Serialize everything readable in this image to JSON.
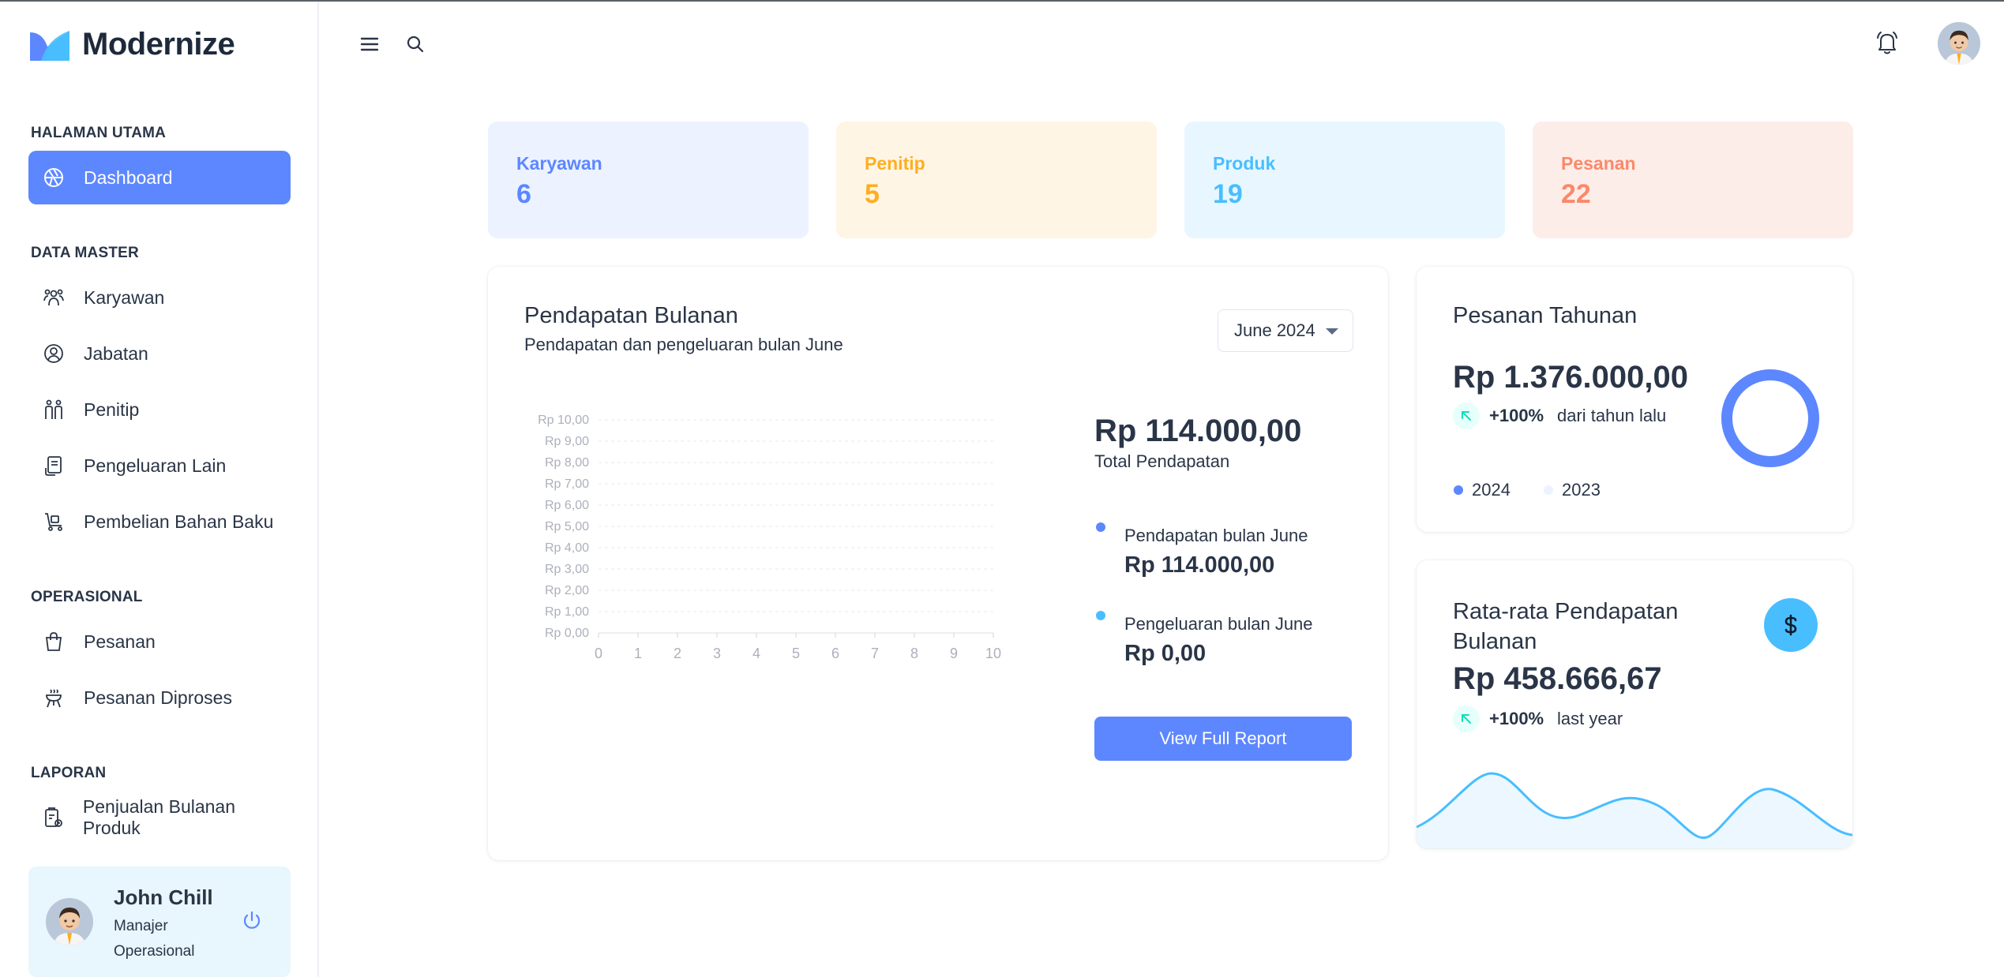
{
  "brand": {
    "name": "Modernize"
  },
  "sidebar": {
    "sections": [
      {
        "title": "HALAMAN UTAMA"
      },
      {
        "title": "DATA MASTER"
      },
      {
        "title": "OPERASIONAL"
      },
      {
        "title": "LAPORAN"
      }
    ],
    "items": [
      {
        "label": "Dashboard",
        "icon": "aperture-icon",
        "active": true
      },
      {
        "label": "Karyawan",
        "icon": "users-icon"
      },
      {
        "label": "Jabatan",
        "icon": "user-circle-icon"
      },
      {
        "label": "Penitip",
        "icon": "friends-icon"
      },
      {
        "label": "Pengeluaran Lain",
        "icon": "receipt-icon"
      },
      {
        "label": "Pembelian Bahan Baku",
        "icon": "cart-icon"
      },
      {
        "label": "Pesanan",
        "icon": "shopping-bag-icon"
      },
      {
        "label": "Pesanan Diproses",
        "icon": "grill-icon"
      },
      {
        "label": "Penjualan Bulanan Produk",
        "icon": "report-icon"
      }
    ]
  },
  "user": {
    "name": "John Chill",
    "role": "Manajer Operasional"
  },
  "stats": [
    {
      "label": "Karyawan",
      "value": "6",
      "color": "#5d87ff",
      "bg": "#ecf2ff"
    },
    {
      "label": "Penitip",
      "value": "5",
      "color": "#ffae1f",
      "bg": "#fef5e5"
    },
    {
      "label": "Produk",
      "value": "19",
      "color": "#49beff",
      "bg": "#e8f7ff"
    },
    {
      "label": "Pesanan",
      "value": "22",
      "color": "#fa896b",
      "bg": "#fdede8"
    }
  ],
  "monthly": {
    "title": "Pendapatan Bulanan",
    "subtitle": "Pendapatan dan pengeluaran bulan June",
    "month_select": "June 2024",
    "total_value": "Rp 114.000,00",
    "total_label": "Total Pendapatan",
    "income_label": "Pendapatan bulan June",
    "income_value": "Rp 114.000,00",
    "expense_label": "Pengeluaran bulan June",
    "expense_value": "Rp 0,00",
    "button": "View Full Report"
  },
  "chart_data": {
    "type": "line",
    "x": [
      0,
      1,
      2,
      3,
      4,
      5,
      6,
      7,
      8,
      9,
      10
    ],
    "y_ticks": [
      "Rp 0,00",
      "Rp 1,00",
      "Rp 2,00",
      "Rp 3,00",
      "Rp 4,00",
      "Rp 5,00",
      "Rp 6,00",
      "Rp 7,00",
      "Rp 8,00",
      "Rp 9,00",
      "Rp 10,00"
    ],
    "xlim": [
      0,
      10
    ],
    "ylim": [
      0,
      10
    ],
    "series": [],
    "grid": true
  },
  "yearly": {
    "title": "Pesanan Tahunan",
    "value": "Rp 1.376.000,00",
    "trend_pct": "+100%",
    "trend_text": "dari tahun lalu",
    "legend": [
      {
        "label": "2024",
        "color": "#5d87ff"
      },
      {
        "label": "2023",
        "color": "#ecf2ff"
      }
    ],
    "donut_color": "#5d87ff"
  },
  "average": {
    "title": "Rata-rata Pendapatan Bulanan",
    "value": "Rp 458.666,67",
    "trend_pct": "+100%",
    "trend_text": "last year",
    "icon": "dollar-icon",
    "accent": "#49beff"
  }
}
